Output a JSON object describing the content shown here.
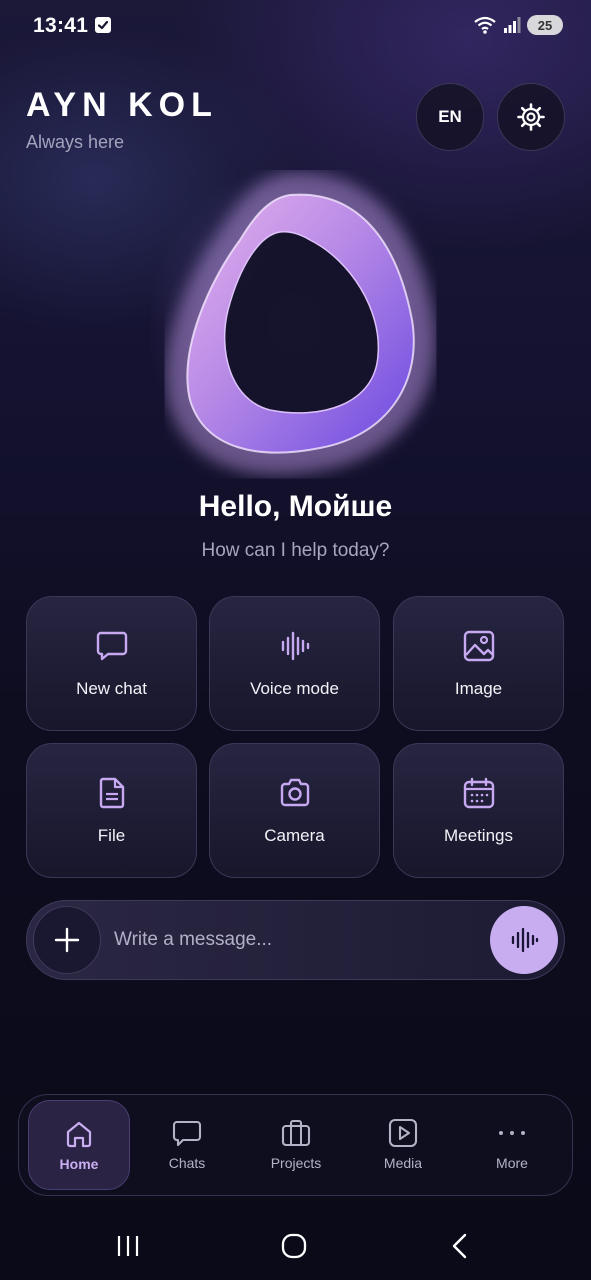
{
  "status_bar": {
    "time": "13:41",
    "battery": "25"
  },
  "header": {
    "title": "AYN KOL",
    "subtitle": "Always here",
    "language": "EN"
  },
  "greeting": {
    "title": "Hello, Мойше",
    "subtitle": "How can I help today?"
  },
  "actions": [
    {
      "label": "New chat",
      "icon": "chat-bubble-icon"
    },
    {
      "label": "Voice mode",
      "icon": "waveform-icon"
    },
    {
      "label": "Image",
      "icon": "image-icon"
    },
    {
      "label": "File",
      "icon": "file-icon"
    },
    {
      "label": "Camera",
      "icon": "camera-icon"
    },
    {
      "label": "Meetings",
      "icon": "calendar-icon"
    }
  ],
  "composer": {
    "placeholder": "Write a message..."
  },
  "nav": [
    {
      "label": "Home",
      "icon": "home-icon",
      "active": true
    },
    {
      "label": "Chats",
      "icon": "chat-bubble-icon",
      "active": false
    },
    {
      "label": "Projects",
      "icon": "briefcase-icon",
      "active": false
    },
    {
      "label": "Media",
      "icon": "play-icon",
      "active": false
    },
    {
      "label": "More",
      "icon": "more-dots-icon",
      "active": false
    }
  ],
  "colors": {
    "accent": "#c8aef0",
    "background": "#0e0d20",
    "tile": "#24223f",
    "icon": "#c6a9f0"
  }
}
